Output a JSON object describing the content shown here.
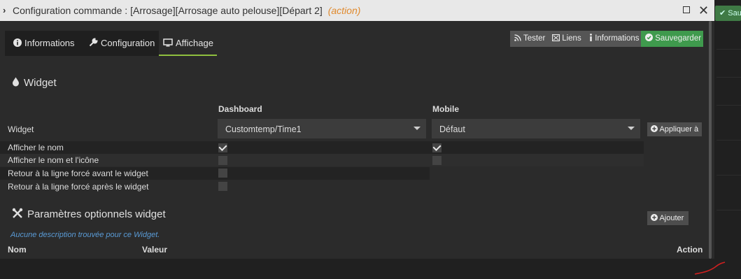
{
  "window": {
    "title_prefix": "Configuration commande : [Arrosage][Arrosage auto pelouse][Départ 2]",
    "title_type": "(action)",
    "chevron": "›",
    "close_glyph": "✕"
  },
  "background": {
    "ghost_button_label": "Sau"
  },
  "tabs": [
    {
      "label": "Informations",
      "icon": "info-circle-icon"
    },
    {
      "label": "Configuration",
      "icon": "wrench-icon"
    },
    {
      "label": "Affichage",
      "icon": "monitor-icon",
      "active": true
    }
  ],
  "toolbar": {
    "tester": "Tester",
    "liens": "Liens",
    "informations": "Informations",
    "sauvegarder": "Sauvegarder"
  },
  "widget_section": {
    "title": "Widget",
    "col_dashboard": "Dashboard",
    "col_mobile": "Mobile",
    "widget_label": "Widget",
    "dashboard_widget": "Customtemp/Time1",
    "mobile_widget": "Défaut",
    "apply_button": "Appliquer à",
    "rows": [
      {
        "label": "Afficher le nom",
        "dashboard": true,
        "mobile": true
      },
      {
        "label": "Afficher le nom et l'icône",
        "dashboard": false,
        "mobile": false
      },
      {
        "label": "Retour à la ligne forcé avant le widget",
        "dashboard": false
      },
      {
        "label": "Retour à la ligne forcé après le widget",
        "dashboard": false
      }
    ]
  },
  "params_section": {
    "title": "Paramètres optionnels widget",
    "add_button": "Ajouter",
    "note": "Aucune description trouvée pour ce Widget.",
    "columns": [
      "Nom",
      "Valeur",
      "Action"
    ]
  },
  "colors": {
    "save_green": "#3f9a4d",
    "active_tab_underline": "#8fbf3f",
    "action_orange": "#e08a2e",
    "note_blue": "#5a9bd6"
  }
}
